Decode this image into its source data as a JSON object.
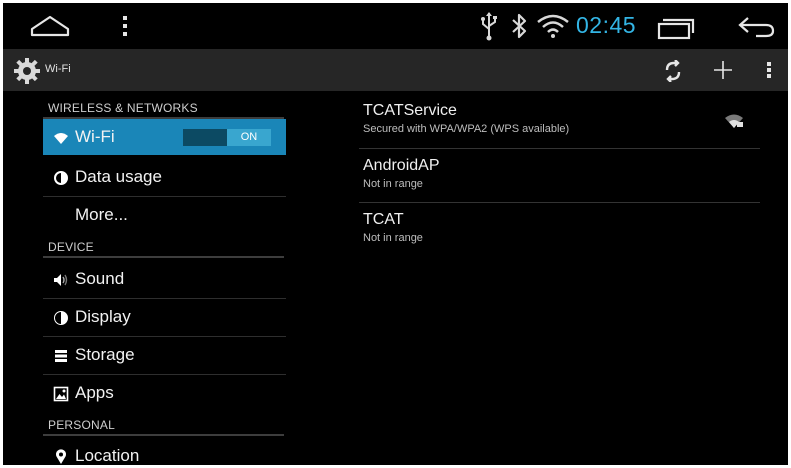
{
  "status_bar": {
    "time": "02:45",
    "clock_color": "#33b5e5"
  },
  "action_bar": {
    "title": "Wi-Fi"
  },
  "sidebar": {
    "sections": [
      {
        "header": "WIRELESS & NETWORKS"
      },
      {
        "header": "DEVICE"
      },
      {
        "header": "PERSONAL"
      }
    ],
    "items": [
      {
        "label": "Wi-Fi",
        "icon": "wifi-icon",
        "selected": true,
        "toggle": "ON"
      },
      {
        "label": "Data usage",
        "icon": "data-usage-icon"
      },
      {
        "label": "More..."
      },
      {
        "label": "Sound",
        "icon": "sound-icon"
      },
      {
        "label": "Display",
        "icon": "display-icon"
      },
      {
        "label": "Storage",
        "icon": "storage-icon"
      },
      {
        "label": "Apps",
        "icon": "apps-icon"
      },
      {
        "label": "Location",
        "icon": "location-icon"
      }
    ]
  },
  "networks": [
    {
      "name": "TCATService",
      "status": "Secured with WPA/WPA2 (WPS available)",
      "icon": "wifi-signal-icon"
    },
    {
      "name": "AndroidAP",
      "status": "Not in range"
    },
    {
      "name": "TCAT",
      "status": "Not in range"
    }
  ],
  "colors": {
    "accent": "#33b5e5",
    "selected_row": "#1a86b8",
    "toggle_on": "#39a6cf"
  }
}
